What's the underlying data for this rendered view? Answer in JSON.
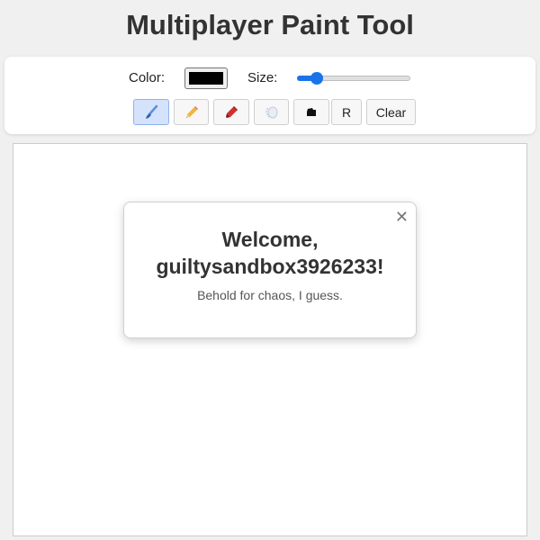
{
  "app": {
    "title": "Multiplayer Paint Tool"
  },
  "toolbar": {
    "color_label": "Color:",
    "color_value": "#000000",
    "size_label": "Size:",
    "size_slider_fraction": 0.13,
    "tools": [
      {
        "name": "brush-tool-button",
        "icon": "paintbrush-icon",
        "active": true
      },
      {
        "name": "pencil-tool-button",
        "icon": "pencil-icon",
        "active": false
      },
      {
        "name": "marker-tool-button",
        "icon": "marker-icon",
        "active": false
      },
      {
        "name": "spray-tool-button",
        "icon": "spray-icon",
        "active": false
      },
      {
        "name": "fill-tool-button",
        "icon": "fill-icon",
        "active": false
      }
    ],
    "r_label": "R",
    "clear_label": "Clear"
  },
  "modal": {
    "heading_line1": "Welcome,",
    "heading_line2": "guiltysandbox3926233!",
    "message": "Behold for chaos, I guess.",
    "close_glyph": "✕"
  },
  "colors": {
    "accent": "#1a73e8",
    "active_tool_bg": "#d4e3fb",
    "page_bg": "#f0f0f0"
  }
}
